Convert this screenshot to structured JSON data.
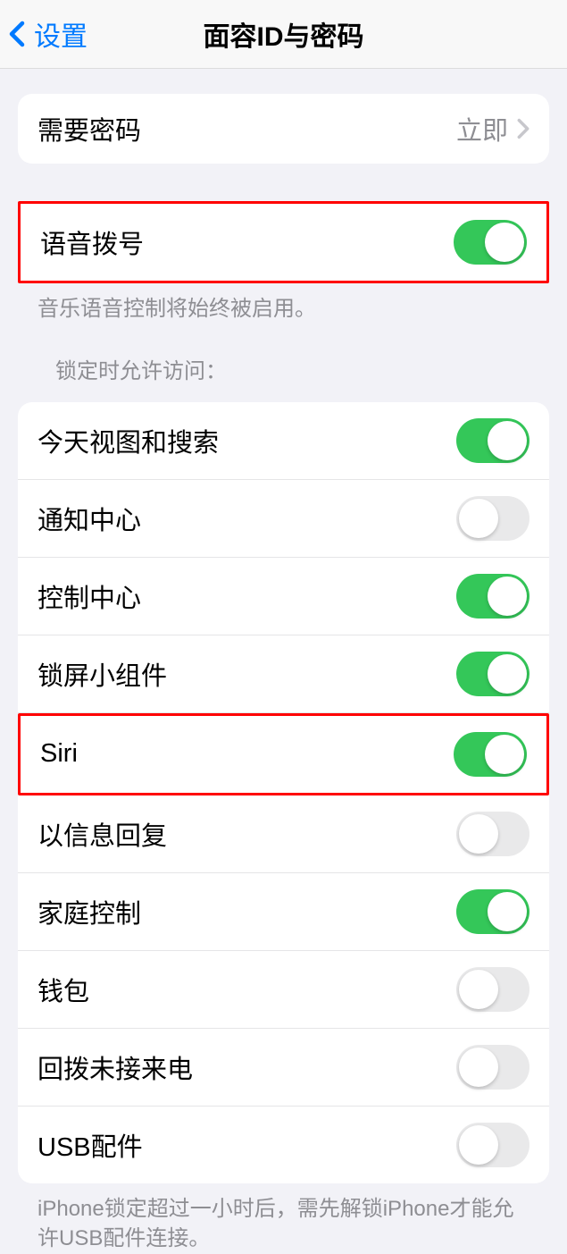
{
  "header": {
    "back_label": "设置",
    "title": "面容ID与密码"
  },
  "passcode_section": {
    "require_passcode_label": "需要密码",
    "require_passcode_value": "立即"
  },
  "voice_section": {
    "voice_dial_label": "语音拨号",
    "voice_dial_on": true,
    "footer": "音乐语音控制将始终被启用。"
  },
  "locked_section": {
    "header": "锁定时允许访问：",
    "items": [
      {
        "label": "今天视图和搜索",
        "on": true
      },
      {
        "label": "通知中心",
        "on": false
      },
      {
        "label": "控制中心",
        "on": true
      },
      {
        "label": "锁屏小组件",
        "on": true
      },
      {
        "label": "Siri",
        "on": true,
        "highlighted": true
      },
      {
        "label": "以信息回复",
        "on": false
      },
      {
        "label": "家庭控制",
        "on": true
      },
      {
        "label": "钱包",
        "on": false
      },
      {
        "label": "回拨未接来电",
        "on": false
      },
      {
        "label": "USB配件",
        "on": false
      }
    ],
    "footer": "iPhone锁定超过一小时后，需先解锁iPhone才能允许USB配件连接。"
  }
}
